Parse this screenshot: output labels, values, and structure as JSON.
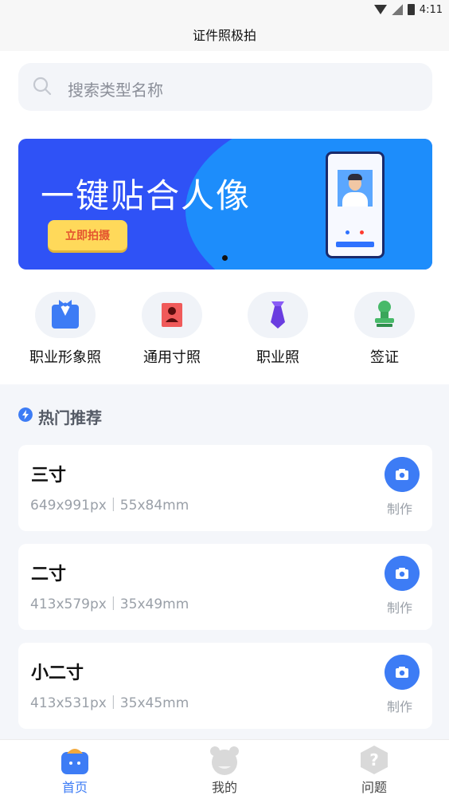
{
  "status_bar": {
    "time": "4:11"
  },
  "header": {
    "title": "证件照极拍"
  },
  "search": {
    "placeholder": "搜索类型名称"
  },
  "banner": {
    "title": "一键贴合人像",
    "button_label": "立即拍摄"
  },
  "categories": [
    {
      "label": "职业形象照",
      "icon": "suit-icon"
    },
    {
      "label": "通用寸照",
      "icon": "portrait-icon"
    },
    {
      "label": "职业照",
      "icon": "tie-icon"
    },
    {
      "label": "签证",
      "icon": "stamp-icon"
    }
  ],
  "hot": {
    "title": "热门推荐",
    "items": [
      {
        "name": "三寸",
        "spec": "649x991px｜55x84mm",
        "action": "制作"
      },
      {
        "name": "二寸",
        "spec": "413x579px｜35x49mm",
        "action": "制作"
      },
      {
        "name": "小二寸",
        "spec": "413x531px｜35x45mm",
        "action": "制作"
      }
    ]
  },
  "nav": [
    {
      "label": "首页",
      "icon": "home-icon",
      "active": true
    },
    {
      "label": "我的",
      "icon": "profile-icon",
      "active": false
    },
    {
      "label": "问题",
      "icon": "question-icon",
      "active": false
    }
  ],
  "colors": {
    "accent": "#3d7cf5",
    "banner": "#2f52f6",
    "banner_light": "#1d8dfb",
    "button_yellow": "#ffd95a"
  }
}
